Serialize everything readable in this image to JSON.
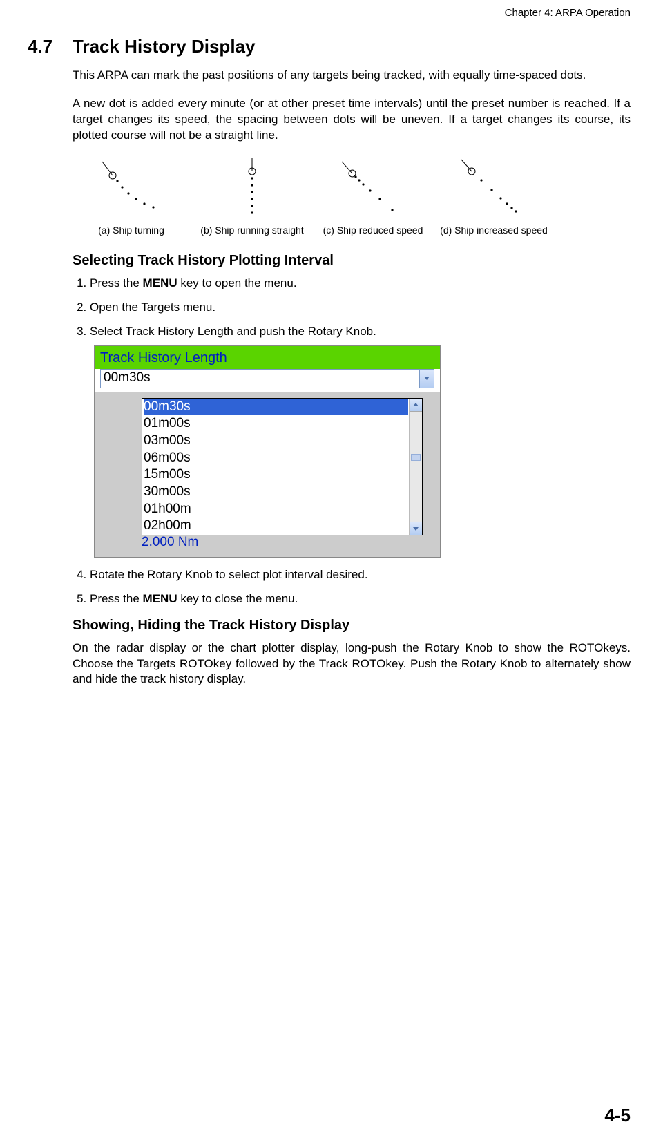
{
  "chapter_header": "Chapter 4: ARPA Operation",
  "section": {
    "number": "4.7",
    "title": "Track History Display"
  },
  "para1": "This ARPA can mark the past positions of any targets being tracked, with equally time-spaced dots.",
  "para2": "A new dot is added every minute (or at other preset time intervals) until the preset number is reached. If a target changes its speed, the spacing between dots will be uneven. If a target changes its course, its plotted course will not be a straight line.",
  "diagrams": [
    {
      "label": "(a) Ship turning"
    },
    {
      "label": "(b) Ship running straight"
    },
    {
      "label": "(c) Ship reduced speed"
    },
    {
      "label": "(d) Ship increased speed"
    }
  ],
  "subsection1": {
    "heading": "Selecting Track History Plotting Interval",
    "steps": {
      "s1_pre": "Press the ",
      "s1_bold": "MENU",
      "s1_post": " key to open the menu.",
      "s2": "Open the Targets menu.",
      "s3": "Select Track History Length and push the Rotary Knob.",
      "s4": "Rotate the Rotary Knob to select plot interval desired.",
      "s5_pre": "Press the ",
      "s5_bold": "MENU",
      "s5_post": " key to close the menu."
    }
  },
  "ui": {
    "title": "Track History Length",
    "current": "00m30s",
    "options": [
      "00m30s",
      "01m00s",
      "03m00s",
      "06m00s",
      "15m00s",
      "30m00s",
      "01h00m",
      "02h00m"
    ],
    "under_text": "2.000 Nm"
  },
  "subsection2": {
    "heading": "Showing, Hiding the Track History Display",
    "para": "On the radar display or the chart plotter display, long-push the Rotary Knob to show the ROTOkeys. Choose the Targets ROTOkey followed by the Track ROTOkey. Push the Rotary Knob to alternately show and hide the track history display."
  },
  "page_number": "4-5"
}
